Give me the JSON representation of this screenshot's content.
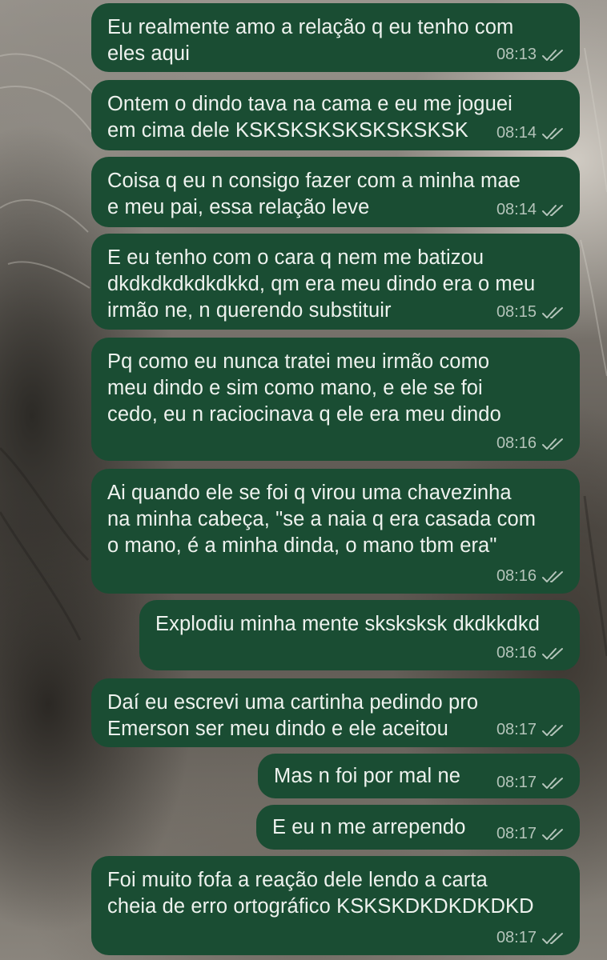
{
  "messages": [
    {
      "text": "Eu realmente amo a relação q eu tenho com\neles aqui",
      "time": "08:13",
      "status_icon": "double-check-icon"
    },
    {
      "text": "Ontem o dindo tava na cama e eu me joguei\nem cima dele KSKSKSKSKSKSKSKSK",
      "time": "08:14",
      "status_icon": "double-check-icon"
    },
    {
      "text": "Coisa q eu n consigo fazer com a minha mae\ne meu pai, essa relação leve",
      "time": "08:14",
      "status_icon": "double-check-icon"
    },
    {
      "text": "E eu tenho com o cara q nem me batizou\ndkdkdkdkdkdkkd, qm era meu dindo era o meu\nirmão ne, n querendo substituir",
      "time": "08:15",
      "status_icon": "double-check-icon"
    },
    {
      "text": "Pq como eu nunca tratei meu irmão como\nmeu dindo e sim como mano, e ele se foi\ncedo, eu n raciocinava q ele era meu dindo",
      "time": "08:16",
      "status_icon": "double-check-icon"
    },
    {
      "text": "Ai quando ele se foi q virou uma chavezinha\nna minha cabeça, \"se a naia q era casada com\no mano, é a minha dinda, o mano tbm era\"",
      "time": "08:16",
      "status_icon": "double-check-icon"
    },
    {
      "text": "Explodiu minha mente sksksksk dkdkkdkd",
      "time": "08:16",
      "status_icon": "double-check-icon"
    },
    {
      "text": "Daí eu escrevi uma cartinha pedindo pro\nEmerson ser meu dindo e ele aceitou",
      "time": "08:17",
      "status_icon": "double-check-icon"
    },
    {
      "text": "Mas n foi por mal ne",
      "time": "08:17",
      "status_icon": "double-check-icon"
    },
    {
      "text": "E eu n me arrependo",
      "time": "08:17",
      "status_icon": "double-check-icon"
    },
    {
      "text": "Foi muito fofa a reação dele lendo a carta\ncheia de erro ortográfico KSKSKDKDKDKDKD",
      "time": "08:17",
      "status_icon": "double-check-icon"
    }
  ],
  "colors": {
    "bubble": "#1a4d33",
    "bubble_text": "#eef2ee",
    "meta_text": "#b4c4ba"
  }
}
